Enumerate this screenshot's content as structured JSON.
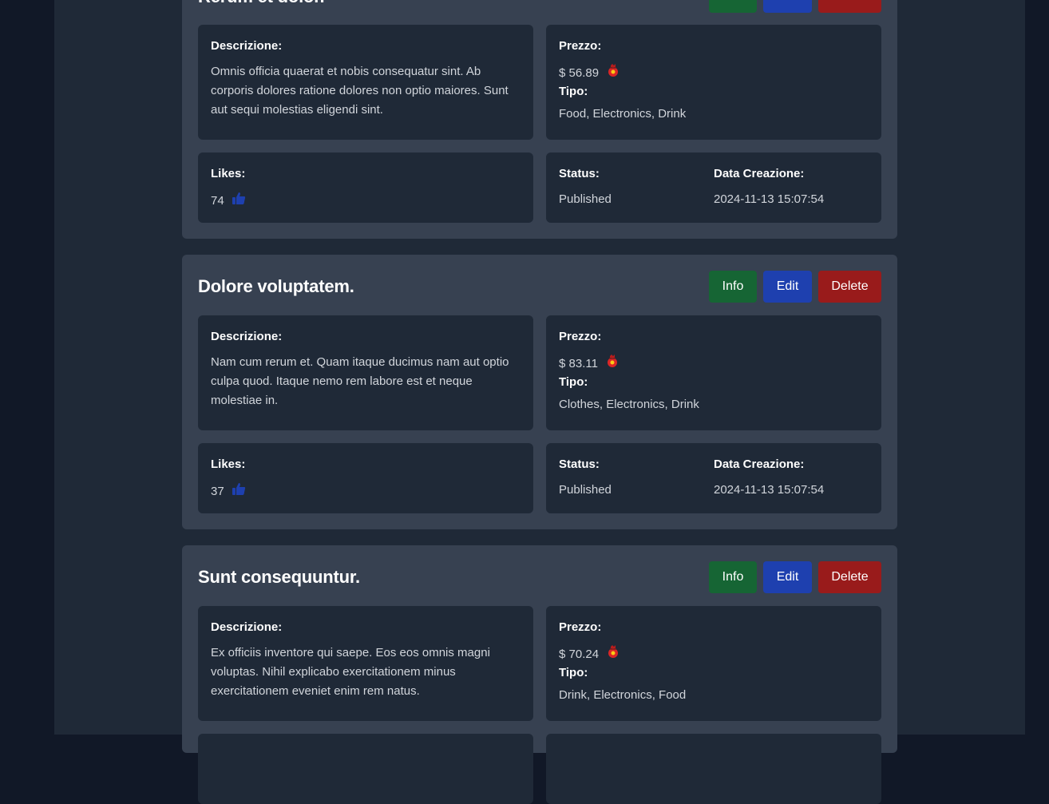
{
  "labels": {
    "descrizione": "Descrizione:",
    "prezzo": "Prezzo:",
    "tipo": "Tipo:",
    "likes": "Likes:",
    "status": "Status:",
    "data_creazione": "Data Creazione:",
    "info_btn": "Info",
    "edit_btn": "Edit",
    "delete_btn": "Delete"
  },
  "colors": {
    "info": "#166534",
    "edit": "#1e40af",
    "delete": "#991b1b",
    "like_icon": "#1e40af"
  },
  "cards": [
    {
      "title": "Rerum et dolor.",
      "description": "Omnis officia quaerat et nobis consequatur sint. Ab corporis dolores ratione dolores non optio maiores. Sunt aut sequi molestias eligendi sint.",
      "price": "$ 56.89",
      "tipo": "Food, Electronics, Drink",
      "likes": "74",
      "status": "Published",
      "created": "2024-11-13 15:07:54"
    },
    {
      "title": "Dolore voluptatem.",
      "description": "Nam cum rerum et. Quam itaque ducimus nam aut optio culpa quod. Itaque nemo rem labore est et neque molestiae in.",
      "price": "$ 83.11",
      "tipo": "Clothes, Electronics, Drink",
      "likes": "37",
      "status": "Published",
      "created": "2024-11-13 15:07:54"
    },
    {
      "title": "Sunt consequuntur.",
      "description": "Ex officiis inventore qui saepe. Eos eos omnis magni voluptas. Nihil explicabo exercitationem minus exercitationem eveniet enim rem natus.",
      "price": "$ 70.24",
      "tipo": "Drink, Electronics, Food"
    }
  ]
}
